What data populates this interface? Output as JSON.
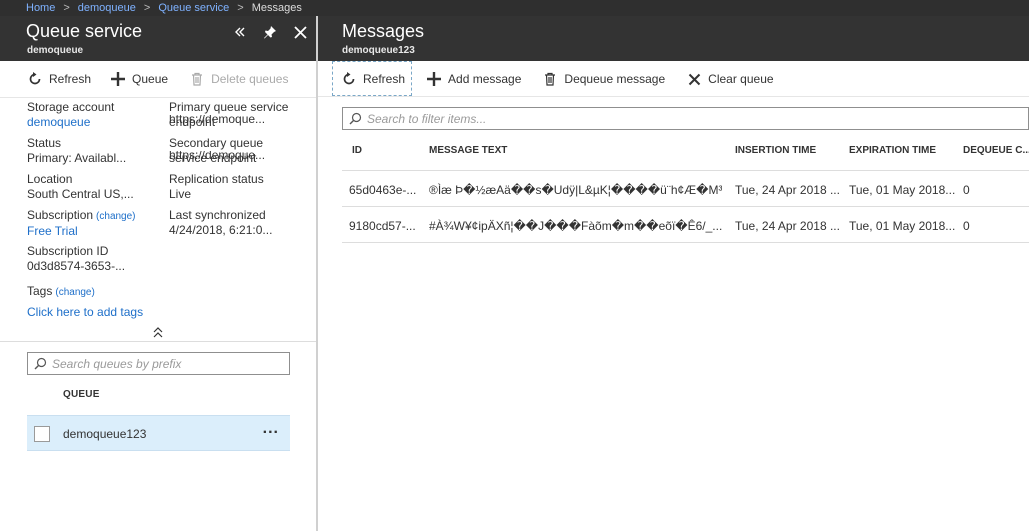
{
  "breadcrumb": {
    "items": [
      "Home",
      "demoqueue",
      "Queue service"
    ],
    "current": "Messages"
  },
  "left_blade": {
    "title": "Queue service",
    "subtitle": "demoqueue",
    "toolbar": {
      "refresh": "Refresh",
      "queue": "Queue",
      "delete_queues": "Delete queues"
    },
    "essentials": {
      "storage_account_label": "Storage account",
      "storage_account_value": "demoqueue",
      "status_label": "Status",
      "status_value": "Primary: Availabl...",
      "location_label": "Location",
      "location_value": "South Central US,...",
      "subscription_label": "Subscription",
      "subscription_change": "(change)",
      "subscription_value": "Free Trial",
      "subscription_id_label": "Subscription ID",
      "subscription_id_value": "0d3d8574-3653-...",
      "primary_endpoint_label": "Primary queue service",
      "primary_endpoint_label2": "endpoint",
      "primary_endpoint_value": "https://demoque...",
      "secondary_endpoint_label": "Secondary queue",
      "secondary_endpoint_label2": "service endpoint",
      "secondary_endpoint_value": "https://demoque...",
      "replication_label": "Replication status",
      "replication_value": "Live",
      "last_sync_label": "Last synchronized",
      "last_sync_value": "4/24/2018, 6:21:0...",
      "tags_label": "Tags",
      "tags_change": "(change)",
      "tags_link": "Click here to add tags"
    },
    "search_placeholder": "Search queues by prefix",
    "queue_column_header": "QUEUE",
    "queues": [
      {
        "name": "demoqueue123",
        "more": "..."
      }
    ]
  },
  "right_blade": {
    "title": "Messages",
    "subtitle": "demoqueue123",
    "toolbar": {
      "refresh": "Refresh",
      "add_message": "Add message",
      "dequeue_message": "Dequeue message",
      "clear_queue": "Clear queue"
    },
    "filter_placeholder": "Search to filter items...",
    "columns": [
      "ID",
      "MESSAGE TEXT",
      "INSERTION TIME",
      "EXPIRATION TIME",
      "DEQUEUE C..."
    ],
    "rows": [
      {
        "id": "65d0463e-...",
        "text": "®Ìæ Þ�½æAä��s�Udÿ|L&µK¦����ü¨h¢Æ�M³...",
        "insertion": "Tue, 24 Apr 2018 ...",
        "expiration": "Tue, 01 May 2018...",
        "dequeue": "0"
      },
      {
        "id": "9180cd57-...",
        "text": "#À¾W¥¢ipÄXñ¦��J���Fàõm�m��eõï�Ê6/_...",
        "insertion": "Tue, 24 Apr 2018 ...",
        "expiration": "Tue, 01 May 2018...",
        "dequeue": "0"
      }
    ]
  },
  "colors": {
    "header_bg": "#333333",
    "topbar_bg": "#2f2f2f",
    "link": "#1e6fc9",
    "selected_row": "#dbeefb"
  }
}
